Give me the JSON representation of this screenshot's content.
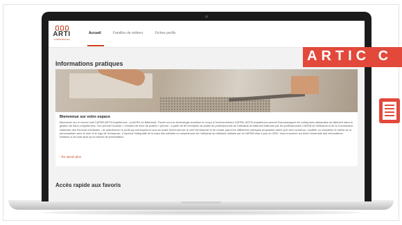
{
  "app": {
    "logo_text": "ARTI",
    "logo_sub": "COMPÉTENCES"
  },
  "nav": {
    "tabs": [
      {
        "label": "Accueil",
        "active": true
      },
      {
        "label": "Familles de métiers",
        "active": false
      },
      {
        "label": "Fiches profils",
        "active": false
      }
    ]
  },
  "main": {
    "section_title": "Informations pratiques",
    "card": {
      "title": "Bienvenue sur votre espace",
      "body": "Bienvenue sur le nouvel outil CAPEB ARTICompétences - (outil RH du Bâtiment). Fondé sur une technologie évolutive et conçu à l'environnement CAPEB, ARTICompétences permet d'accompagner les entreprises artisanales du bâtiment dans la gestion de leurs compétences. Son premier module « Création de fiche de postes » permet - à partir de 80 exemples de profils de professionnels de l'artisanat du bâtiment élaborés par les professionnels CAPEB de l'Artisanat et de la Commission Nationale des Femmes d'Artisans - de sélectionner le profil qui correspond le plus au poste recherché par le chef d'entreprise et de choisir parmi les différentes rubriques proposées celles qu'il veut conserver, modifier ou compléter et même de la personnaliser avec le nom et le logo de l'entreprise. Il reprend l'intégralité de la base des activités et compétences de l'artisanat du bâtiment réalisée par la CAPEB mise à jour en 2020. Vous trouverez sur Artur l'ensemble des informations relatives à cet outil ainsi qu'un tutoriel de présentation.",
      "more_link": "En savoir plus"
    },
    "section_title_2": "Accès rapide aux favoris"
  },
  "banner": {
    "text": "ARTIC C"
  },
  "colors": {
    "accent": "#c8401f",
    "banner": "#e2493b"
  },
  "icons": [
    "logo-icon",
    "document-icon",
    "chevron-right-icon"
  ]
}
